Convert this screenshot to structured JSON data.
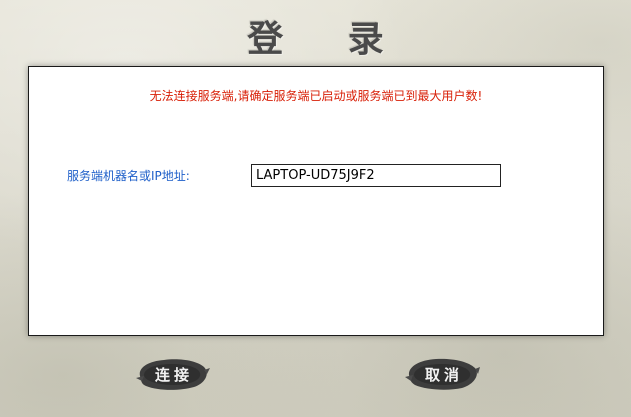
{
  "window": {
    "title": "登 录"
  },
  "panel": {
    "error_message": "无法连接服务端,请确定服务端已启动或服务端已到最大用户数!",
    "server_label": "服务端机器名或IP地址:",
    "server_value": "LAPTOP-UD75J9F2"
  },
  "buttons": {
    "connect_label": "连接",
    "cancel_label": "取消"
  },
  "colors": {
    "error": "#d81e06",
    "label": "#1e5fc9",
    "background": "#dcdace",
    "ink": "#3a3a3a"
  }
}
